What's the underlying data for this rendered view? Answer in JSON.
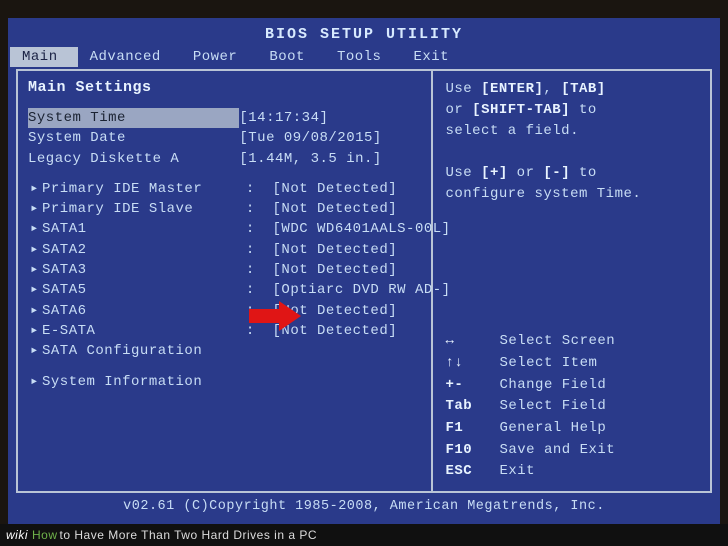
{
  "title": "BIOS SETUP UTILITY",
  "menu": [
    "Main",
    "Advanced",
    "Power",
    "Boot",
    "Tools",
    "Exit"
  ],
  "active_menu": 0,
  "section_title": "Main Settings",
  "settings": [
    {
      "label": "System Time",
      "value": "[14:17:34]",
      "selected": true
    },
    {
      "label": "System Date",
      "value": "[Tue 09/08/2015]",
      "selected": false
    },
    {
      "label": "Legacy Diskette A",
      "value": "[1.44M, 3.5 in.]",
      "selected": false
    }
  ],
  "devices": [
    {
      "label": "Primary IDE Master",
      "value": ":  [Not Detected]"
    },
    {
      "label": "Primary IDE Slave",
      "value": ":  [Not Detected]"
    },
    {
      "label": "SATA1",
      "value": ":  [WDC WD6401AALS-00L]"
    },
    {
      "label": "SATA2",
      "value": ":  [Not Detected]"
    },
    {
      "label": "SATA3",
      "value": ":  [Not Detected]"
    },
    {
      "label": "SATA5",
      "value": ":  [Optiarc DVD RW AD-]"
    },
    {
      "label": "SATA6",
      "value": ":  [Not Detected]"
    },
    {
      "label": "E-SATA",
      "value": ":  [Not Detected]"
    },
    {
      "label": "SATA Configuration",
      "value": ""
    }
  ],
  "extra": [
    {
      "label": "System Information",
      "value": ""
    }
  ],
  "help": {
    "line1a": "Use ",
    "enter": "[ENTER]",
    "comma": ", ",
    "tab": "[TAB]",
    "line2a": "or ",
    "shifttab": "[SHIFT-TAB]",
    "line2b": " to",
    "line3": "select a field.",
    "line4a": "Use ",
    "plus": "[+]",
    "line4b": " or ",
    "minus": "[-]",
    "line4c": " to",
    "line5": "configure system Time."
  },
  "keys": [
    {
      "k": "↔",
      "d": "Select Screen"
    },
    {
      "k": "↑↓",
      "d": "Select Item"
    },
    {
      "k": "+-",
      "d": "Change Field"
    },
    {
      "k": "Tab",
      "d": "Select Field"
    },
    {
      "k": "F1",
      "d": "General Help"
    },
    {
      "k": "F10",
      "d": "Save and Exit"
    },
    {
      "k": "ESC",
      "d": "Exit"
    }
  ],
  "footer": "v02.61 (C)Copyright 1985-2008, American Megatrends, Inc.",
  "caption": {
    "brand": "wiki",
    "how": "How",
    "rest": " to Have More Than Two Hard Drives in a PC"
  }
}
